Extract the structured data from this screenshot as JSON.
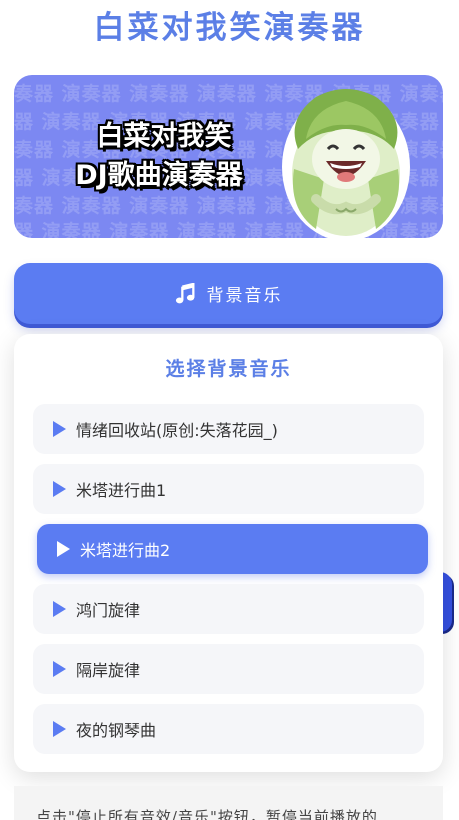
{
  "app": {
    "title": "白菜对我笑演奏器"
  },
  "banner": {
    "line1": "白菜对我笑",
    "line2": "DJ歌曲演奏器",
    "watermark": "演奏器"
  },
  "bgm_button": {
    "label": "背景音乐",
    "icon": "music-note-icon"
  },
  "panel": {
    "title": "选择背景音乐",
    "tracks": [
      {
        "label": "情绪回收站(原创:失落花园_)",
        "active": false
      },
      {
        "label": "米塔进行曲1",
        "active": false
      },
      {
        "label": "米塔进行曲2",
        "active": true
      },
      {
        "label": "鸿门旋律",
        "active": false
      },
      {
        "label": "隔岸旋律",
        "active": false
      },
      {
        "label": "夜的钢琴曲",
        "active": false
      }
    ]
  },
  "note": {
    "text": "点击\"停止所有音效/音乐\"按钮，暂停当前播放的"
  },
  "colors": {
    "accent": "#5b7cf2",
    "title": "#5b7fe6",
    "banner": "#7c88f2"
  }
}
